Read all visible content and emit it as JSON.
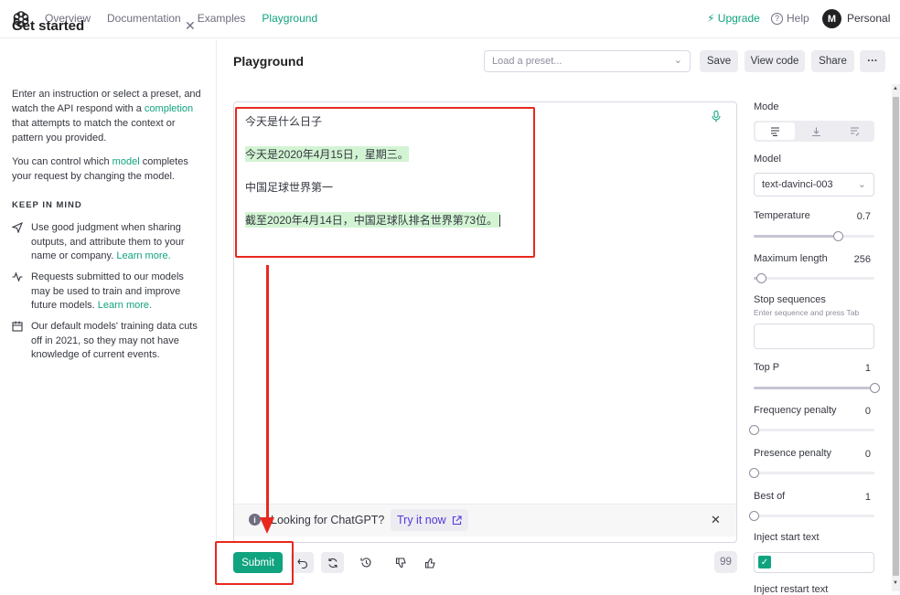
{
  "nav": {
    "items": [
      "Overview",
      "Documentation",
      "Examples",
      "Playground"
    ],
    "active_index": 3,
    "upgrade": "Upgrade",
    "help": "Help",
    "avatar_letter": "M",
    "account": "Personal"
  },
  "sidebar": {
    "title": "Get started",
    "intro_pre": "Enter an instruction or select a preset, and watch the API respond with a ",
    "intro_link": "completion",
    "intro_post": " that attempts to match the context or pattern you provided.",
    "model_pre": "You can control which ",
    "model_link": "model",
    "model_post": " completes your request by changing the model.",
    "keep_in_mind": "KEEP IN MIND",
    "tips": [
      {
        "text": "Use good judgment when sharing outputs, and attribute them to your name or company. ",
        "link": "Learn more."
      },
      {
        "text": "Requests submitted to our models may be used to train and improve future models. ",
        "link": "Learn more."
      },
      {
        "text": "Our default models' training data cuts off in 2021, so they may not have knowledge of current events.",
        "link": ""
      }
    ]
  },
  "playground": {
    "title": "Playground",
    "preset_placeholder": "Load a preset...",
    "save": "Save",
    "view_code": "View code",
    "share": "Share",
    "more": "···"
  },
  "editor": {
    "lines": [
      {
        "text": "今天是什么日子",
        "highlight": false
      },
      {
        "text": "今天是2020年4月15日，星期三。",
        "highlight": true
      },
      {
        "text": "中国足球世界第一",
        "highlight": false
      },
      {
        "text": "截至2020年4月14日，中国足球队排名世界第73位。",
        "highlight": true
      }
    ]
  },
  "chat_banner": {
    "text": "Looking for ChatGPT?",
    "cta": "Try it now"
  },
  "actions": {
    "submit": "Submit",
    "token_count": "99"
  },
  "settings": {
    "mode_label": "Mode",
    "model_label": "Model",
    "model_value": "text-davinci-003",
    "temperature": {
      "label": "Temperature",
      "value": "0.7",
      "fraction": 0.7
    },
    "max_length": {
      "label": "Maximum length",
      "value": "256",
      "fraction": 0.06
    },
    "stop_sequences": {
      "label": "Stop sequences",
      "hint": "Enter sequence and press Tab"
    },
    "top_p": {
      "label": "Top P",
      "value": "1",
      "fraction": 1.0
    },
    "frequency_penalty": {
      "label": "Frequency penalty",
      "value": "0",
      "fraction": 0.0
    },
    "presence_penalty": {
      "label": "Presence penalty",
      "value": "0",
      "fraction": 0.0
    },
    "best_of": {
      "label": "Best of",
      "value": "1",
      "fraction": 0.0
    },
    "inject_start": "Inject start text",
    "inject_restart": "Inject restart text"
  },
  "colors": {
    "accent": "#10a37f",
    "annotation": "#e8281e",
    "highlight": "#d2f4d3"
  }
}
